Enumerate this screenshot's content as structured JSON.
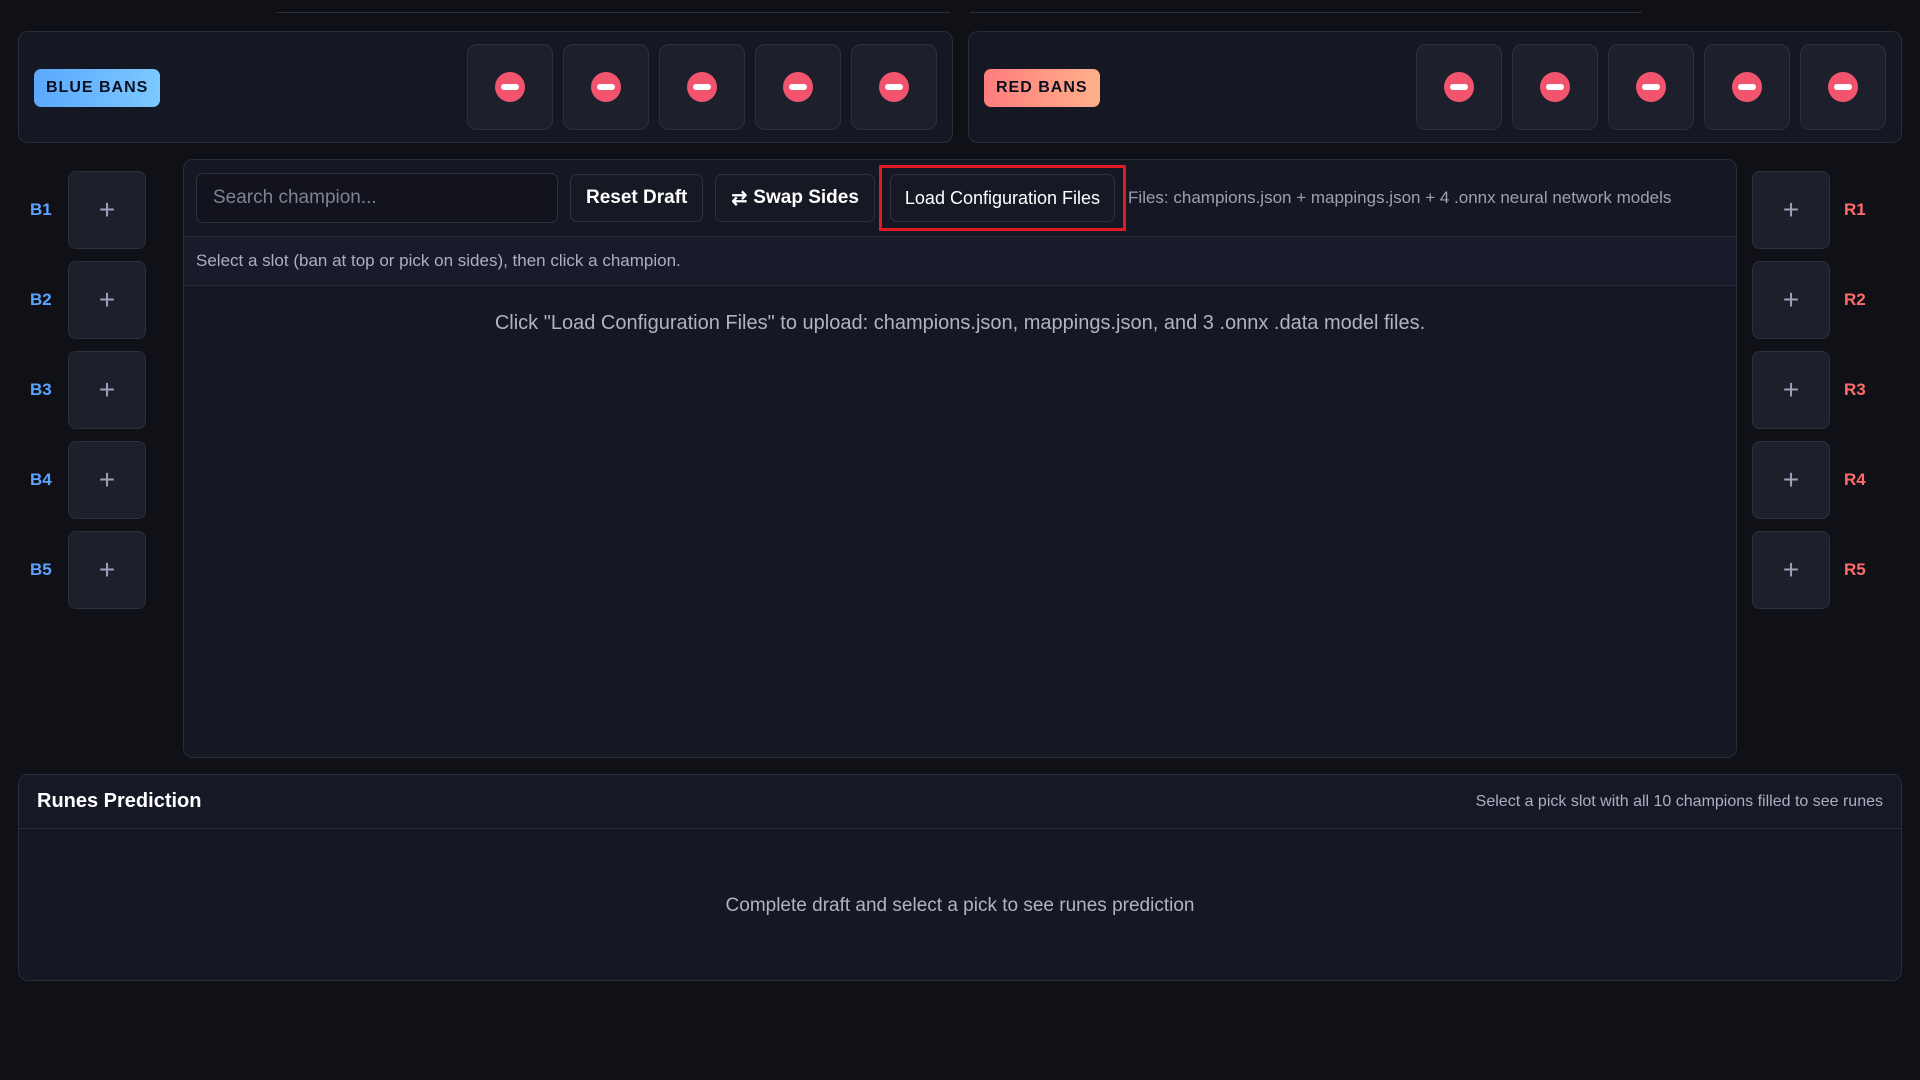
{
  "bans": {
    "blue_label": "BLUE BANS",
    "red_label": "RED BANS"
  },
  "blue_picks": [
    "B1",
    "B2",
    "B3",
    "B4",
    "B5"
  ],
  "red_picks": [
    "R1",
    "R2",
    "R3",
    "R4",
    "R5"
  ],
  "pick_slot_glyph": "+",
  "toolbar": {
    "search_placeholder": "Search champion...",
    "reset_label": "Reset Draft",
    "swap_icon": "⇄",
    "swap_label": "Swap Sides",
    "load_label": "Load Configuration Files",
    "files_note": "Files: champions.json + mappings.json + 4 .onnx neural network models"
  },
  "hint": "Select a slot (ban at top or pick on sides), then click a champion.",
  "center_message": "Click \"Load Configuration Files\" to upload: champions.json, mappings.json, and 3 .onnx .data model files.",
  "runes": {
    "title": "Runes Prediction",
    "note": "Select a pick slot with all 10 champions filled to see runes",
    "empty": "Complete draft and select a pick to see runes prediction"
  },
  "colors": {
    "background": "#101117",
    "blue_accent": "#5ba3ff",
    "red_accent": "#ff6b6b",
    "ban_icon": "#f2536d",
    "highlight": "#e01b24"
  },
  "icons": {
    "ban_slot": "ban-icon",
    "pick_slot": "plus-icon",
    "swap": "swap-arrows-icon"
  }
}
